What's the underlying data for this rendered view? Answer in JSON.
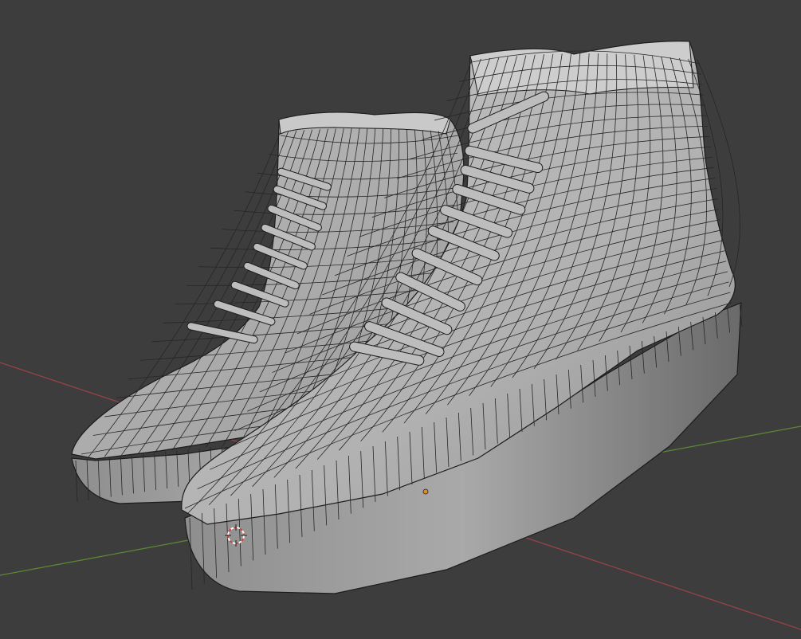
{
  "viewport": {
    "background": "#3d3d3d",
    "shading_mode": "solid-wireframe-overlay",
    "axis_colors": {
      "x_axis": "#a0444a",
      "y_axis": "#5f8a34"
    },
    "mesh_color": "#b4b4b4",
    "wire_color": "#1c1c1c",
    "origin_color": "#e08a2a",
    "cursor_color": "#d0453b"
  },
  "scene": {
    "objects": [
      {
        "name": "left-sneaker",
        "parts": [
          "sole",
          "upper",
          "collar",
          "laces"
        ],
        "lace_count": 9
      },
      {
        "name": "right-sneaker",
        "parts": [
          "sole",
          "upper",
          "collar",
          "laces"
        ],
        "lace_count": 9
      }
    ],
    "cursor_icon": "3d-cursor-icon",
    "origin_icon": "object-origin-icon"
  }
}
